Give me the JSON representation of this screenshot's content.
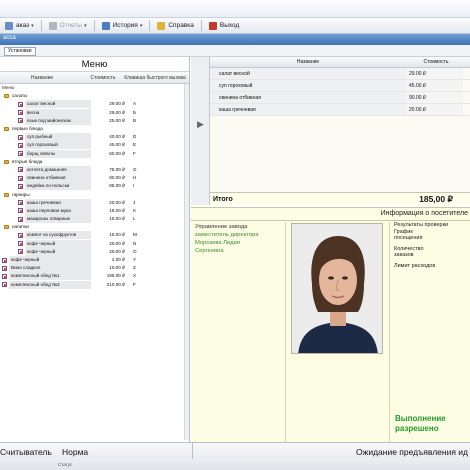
{
  "menubar": {
    "items": [
      {
        "label": "аказ",
        "caret": "▾",
        "disabled": false,
        "icon_color": "#6b8cc7"
      },
      {
        "label": "Отчеты",
        "caret": "▾",
        "disabled": true,
        "icon_color": "#b0b8c4"
      },
      {
        "label": "История",
        "caret": "▾",
        "disabled": false,
        "icon_color": "#4a7fc1"
      },
      {
        "label": "Справка",
        "caret": "",
        "disabled": false,
        "icon_color": "#e0b23a"
      },
      {
        "label": "Выход",
        "caret": "",
        "disabled": false,
        "icon_color": "#c63a2e"
      }
    ]
  },
  "ribbon": {
    "label": "асса"
  },
  "subtool": {
    "tab_label": "Установки"
  },
  "menu": {
    "title": "Меню",
    "columns": [
      "Название",
      "Стоимость",
      "Клавиша быстрого вызова"
    ],
    "root_label": "Меню",
    "rows": [
      {
        "type": "cat",
        "name": "салаты"
      },
      {
        "type": "item",
        "level": "sub",
        "name": "салат весной",
        "price": "29.00 ₽",
        "key": "А"
      },
      {
        "type": "item",
        "level": "sub",
        "name": "весна",
        "price": "29.00 ₽",
        "key": "Б"
      },
      {
        "type": "item",
        "level": "sub",
        "name": "язык под майонезом",
        "price": "25.00 ₽",
        "key": "В"
      },
      {
        "type": "cat",
        "name": "первые блюда"
      },
      {
        "type": "item",
        "level": "sub",
        "name": "суп рыбный",
        "price": "40.00 ₽",
        "key": "D"
      },
      {
        "type": "item",
        "level": "sub",
        "name": "суп гороховый",
        "price": "45.00 ₽",
        "key": "E"
      },
      {
        "type": "item",
        "level": "sub",
        "name": "борщ свёклы",
        "price": "60.00 ₽",
        "key": "F"
      },
      {
        "type": "cat",
        "name": "вторые блюда"
      },
      {
        "type": "item",
        "level": "sub",
        "name": "котлета домашняя",
        "price": "75.00 ₽",
        "key": "G"
      },
      {
        "type": "item",
        "level": "sub",
        "name": "свинина отбивная",
        "price": "90.00 ₽",
        "key": "H"
      },
      {
        "type": "item",
        "level": "sub",
        "name": "индейка по-польски",
        "price": "85.00 ₽",
        "key": "I"
      },
      {
        "type": "cat",
        "name": "гарниры"
      },
      {
        "type": "item",
        "level": "sub",
        "name": "каша гречневая",
        "price": "20.00 ₽",
        "key": "J"
      },
      {
        "type": "item",
        "level": "sub",
        "name": "каша перловая мука",
        "price": "18.00 ₽",
        "key": "K"
      },
      {
        "type": "item",
        "level": "sub",
        "name": "макароны отварные",
        "price": "15.00 ₽",
        "key": "L"
      },
      {
        "type": "cat",
        "name": "напитки"
      },
      {
        "type": "item",
        "level": "sub",
        "name": "компот из сухофруктов",
        "price": "15.00 ₽",
        "key": "M"
      },
      {
        "type": "item",
        "level": "sub",
        "name": "кофе черный",
        "price": "20.00 ₽",
        "key": "N"
      },
      {
        "type": "item",
        "level": "sub",
        "name": "кофе черный",
        "price": "20.00 ₽",
        "key": "O"
      },
      {
        "type": "item",
        "level": "top",
        "name": "кофе черный",
        "price": "2.00 ₽",
        "key": "Y"
      },
      {
        "type": "item",
        "level": "top",
        "name": "Вино сладкое",
        "price": "10.00 ₽",
        "key": "Z"
      },
      {
        "type": "item",
        "level": "top",
        "name": "комплексный обед №1",
        "price": "195.00 ₽",
        "key": "X"
      },
      {
        "type": "item",
        "level": "top",
        "name": "комплексный обед №3",
        "price": "210.00 ₽",
        "key": "F"
      }
    ]
  },
  "order": {
    "columns": [
      "Название",
      "Стоимость"
    ],
    "rows": [
      {
        "name": "салат весной",
        "price": "29.00 ₽"
      },
      {
        "name": "суп гороховый",
        "price": "45.00 ₽"
      },
      {
        "name": "свинина отбивная",
        "price": "90.00 ₽"
      },
      {
        "name": "каша гречневая",
        "price": "20.00 ₽"
      }
    ],
    "total_label": "Итого",
    "total_value": "185,00 ₽"
  },
  "visitor": {
    "title": "Информация о посетителе",
    "department": "Управление завода",
    "position": "заместитель директора",
    "surname_first": "Морозова Лидия",
    "patronymic": "Сергеевна",
    "right_lines": [
      "Результаты проверки",
      "График",
      "посещения",
      "Количество",
      "заказов",
      "Лимит расходов"
    ],
    "access_line1": "Выполнение",
    "access_line2": "разрешено"
  },
  "status": {
    "reader": "Считыватель",
    "norm": "Норма",
    "waiting": "Ожидание предъявления ид",
    "small": "Статус"
  },
  "colors": {
    "accent_green": "#1f9d2b",
    "panel_yellow": "#fdfde3",
    "ribbon_blue": "#3d73b5"
  }
}
